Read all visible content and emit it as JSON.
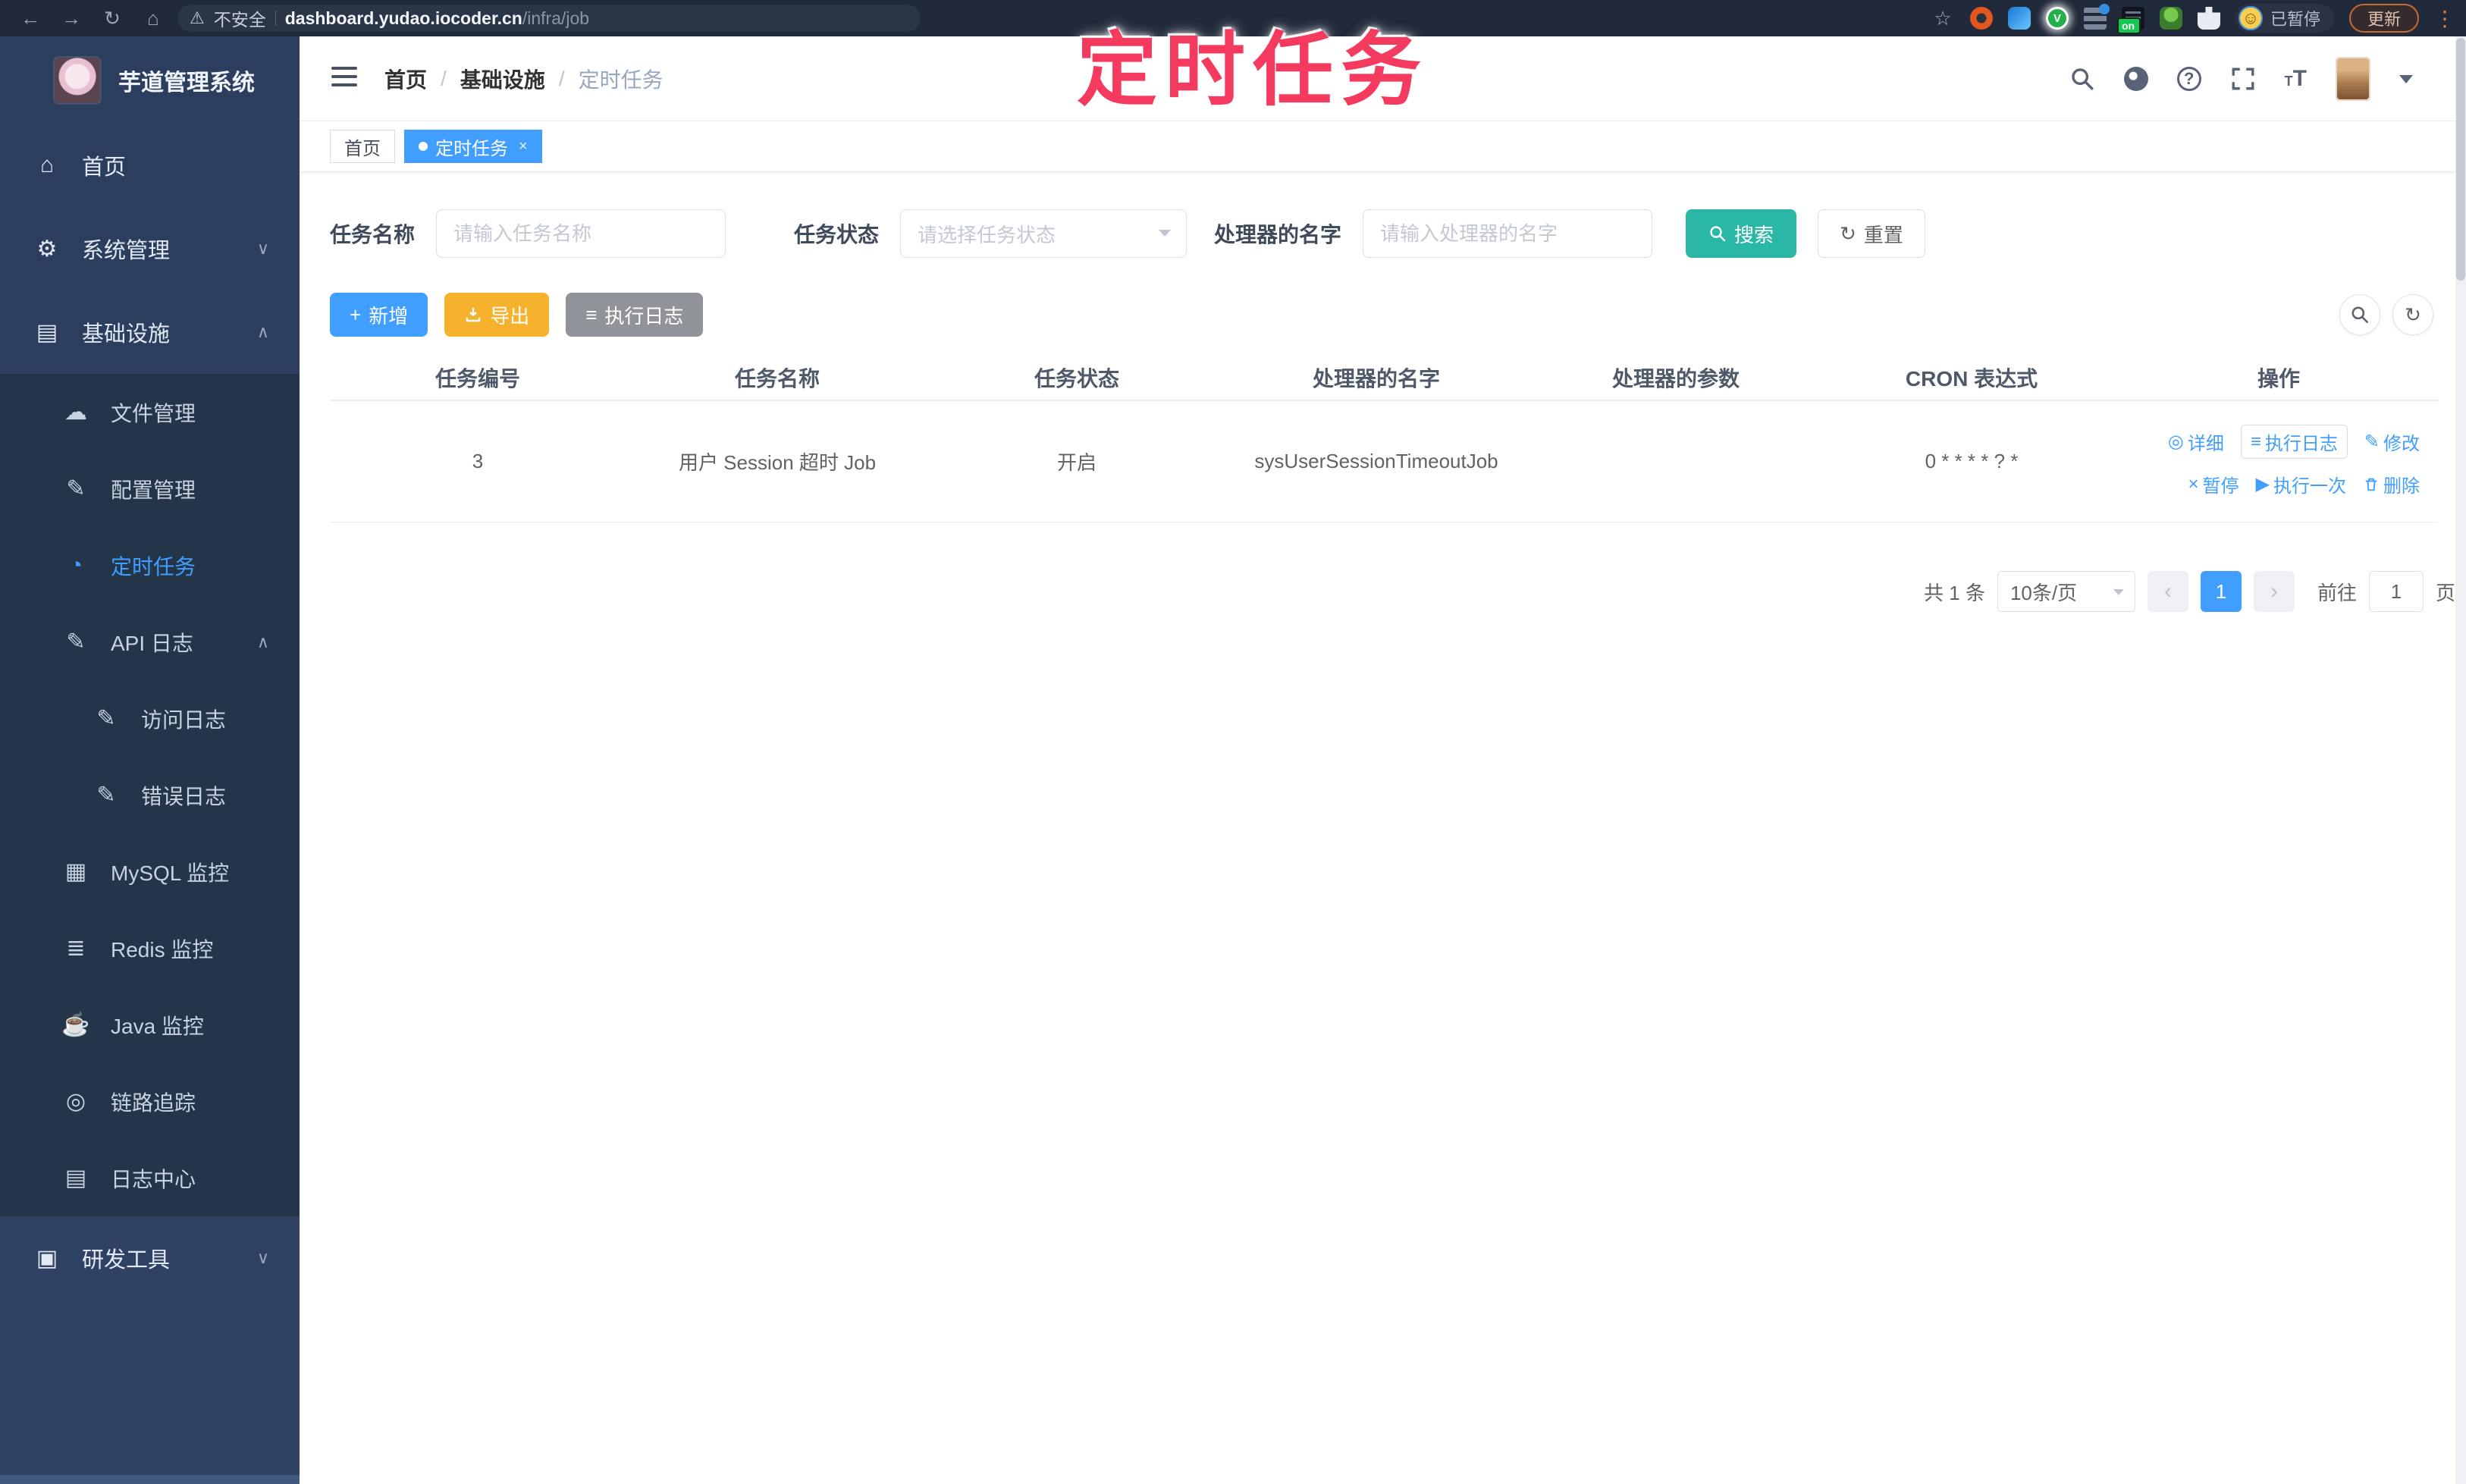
{
  "browser": {
    "security": "不安全",
    "host": "dashboard.yudao.iocoder.cn",
    "path": "/infra/job",
    "paused": "已暂停",
    "update": "更新",
    "ext_badge": "on"
  },
  "watermark": "定时任务",
  "icons": {
    "back": "←",
    "forward": "→",
    "reload": "↻",
    "home_nav": "⌂",
    "warning": "⚠",
    "star": "☆",
    "dots": "⋮",
    "home": "⌂",
    "gear": "⚙",
    "infra": "▤",
    "cloud": "☁",
    "edit": "✎",
    "timer": "◔",
    "apilog": "✎",
    "doc": "✎",
    "mysql": "▦",
    "redis": "≣",
    "java": "☕",
    "trace": "◎",
    "logcenter": "▤",
    "tools": "▣",
    "chevron_down": "∨",
    "chevron_up": "∧",
    "detail": "◎",
    "execlog": "≡",
    "modify": "✎",
    "pause": "×",
    "run": "▶",
    "listlines": "≡",
    "smiley": "☺",
    "plus": "+",
    "prev": "‹",
    "next": "›",
    "refresh": "↻",
    "question": "?"
  },
  "sidebar": {
    "title": "芋道管理系统",
    "items": [
      {
        "label": "首页"
      },
      {
        "label": "系统管理"
      },
      {
        "label": "基础设施"
      },
      {
        "label": "文件管理"
      },
      {
        "label": "配置管理"
      },
      {
        "label": "定时任务"
      },
      {
        "label": "API 日志"
      },
      {
        "label": "访问日志"
      },
      {
        "label": "错误日志"
      },
      {
        "label": "MySQL 监控"
      },
      {
        "label": "Redis 监控"
      },
      {
        "label": "Java 监控"
      },
      {
        "label": "链路追踪"
      },
      {
        "label": "日志中心"
      },
      {
        "label": "研发工具"
      }
    ]
  },
  "header": {
    "breadcrumb": [
      "首页",
      "基础设施",
      "定时任务"
    ]
  },
  "tabs": [
    {
      "label": "首页"
    },
    {
      "label": "定时任务"
    }
  ],
  "filters": {
    "name_label": "任务名称",
    "name_placeholder": "请输入任务名称",
    "status_label": "任务状态",
    "status_placeholder": "请选择任务状态",
    "handler_label": "处理器的名字",
    "handler_placeholder": "请输入处理器的名字",
    "search_label": "搜索",
    "reset_label": "重置"
  },
  "toolbar": {
    "add_label": "新增",
    "export_label": "导出",
    "exec_log_label": "执行日志"
  },
  "table": {
    "headers": [
      "任务编号",
      "任务名称",
      "任务状态",
      "处理器的名字",
      "处理器的参数",
      "CRON 表达式",
      "操作"
    ],
    "row": {
      "id": "3",
      "name": "用户 Session 超时 Job",
      "status": "开启",
      "handler": "sysUserSessionTimeoutJob",
      "params": "",
      "cron": "0 * * * * ? *"
    },
    "actions_row1": [
      "详细",
      "执行日志",
      "修改"
    ],
    "actions_row2": [
      "暂停",
      "执行一次",
      "删除"
    ]
  },
  "pagination": {
    "total": "共 1 条",
    "size": "10条/页",
    "page": "1",
    "goto_label": "前往",
    "goto_value": "1",
    "page_unit": "页"
  }
}
